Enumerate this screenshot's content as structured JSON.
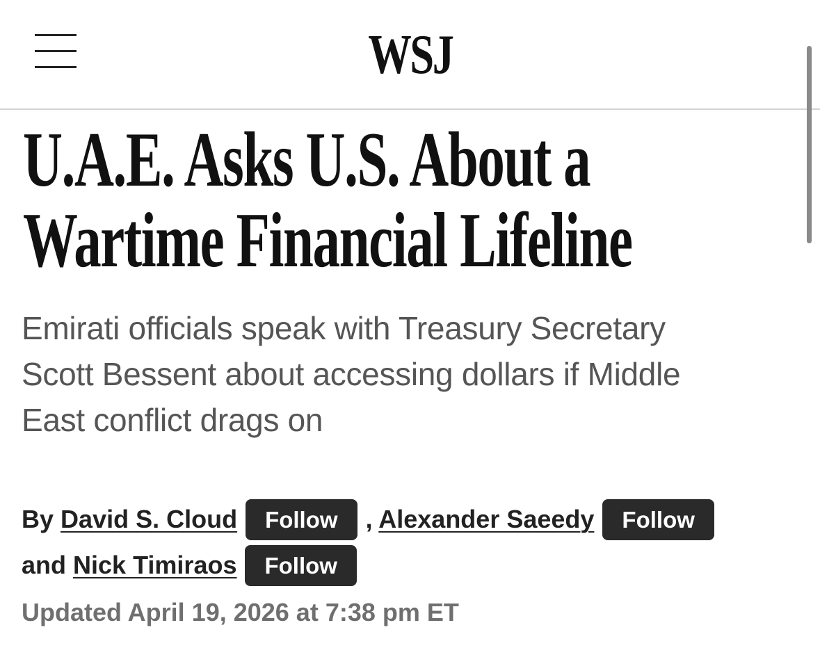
{
  "header": {
    "logo_text": "WSJ",
    "menu_icon": "hamburger-menu-icon"
  },
  "article": {
    "headline_lines": [
      "U.A.E. Asks U.S. About a",
      "Wartime Financial Lifeline"
    ],
    "dek_lines": [
      "Emirati officials speak with Treasury Secretary",
      "Scott Bessent about accessing dollars if Middle",
      "East conflict drags on"
    ],
    "byline": {
      "prefix": "By",
      "separator": ",",
      "conjunction": "and",
      "follow_label": "Follow",
      "authors": [
        "David S. Cloud",
        "Alexander Saeedy",
        "Nick Timiraos"
      ]
    },
    "timestamp": "Updated April 19, 2026 at 7:38 pm ET"
  },
  "colors": {
    "headline": "#111111",
    "dek": "#555555",
    "follow_button_bg": "#2a2a2a",
    "timestamp": "#6f6f6f",
    "divider": "#d2d2d2"
  }
}
